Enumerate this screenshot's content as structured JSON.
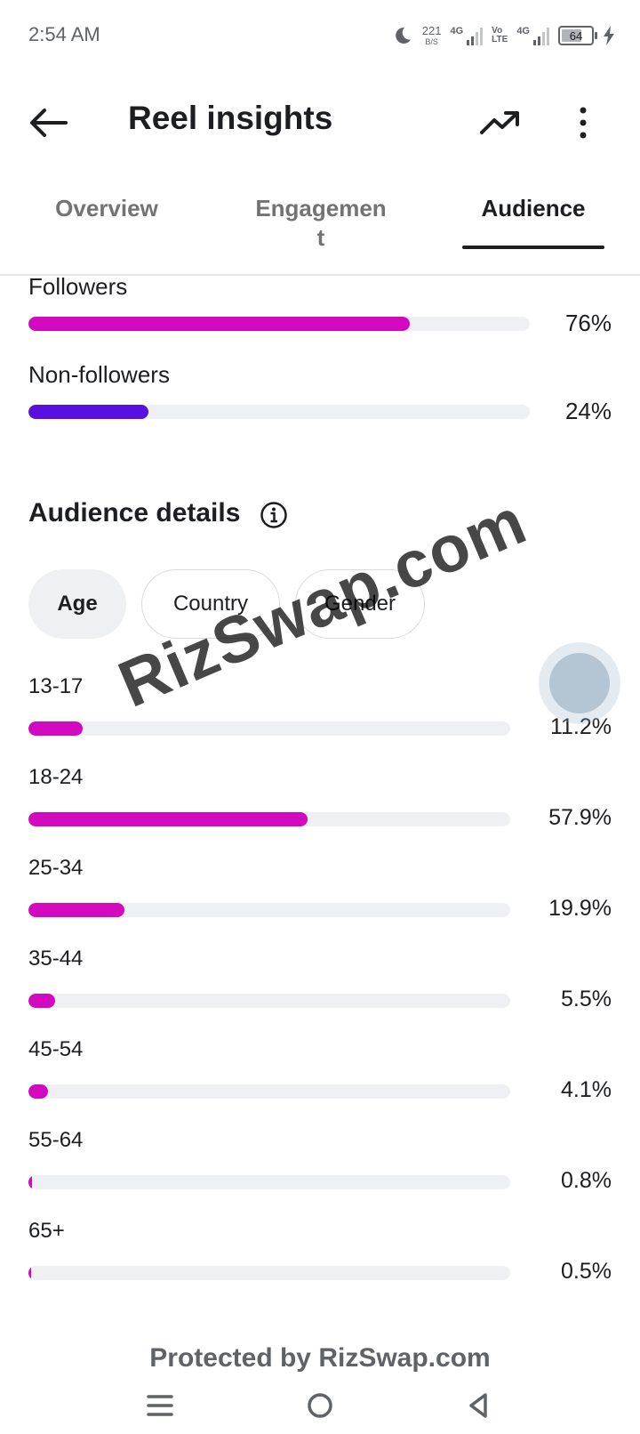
{
  "status_bar": {
    "time": "2:54 AM",
    "net_speed_value": "221",
    "net_speed_unit": "B/S",
    "sim1_label": "4G",
    "volte_top": "Vo",
    "volte_bottom": "LTE",
    "sim2_label": "4G",
    "battery_level": "64"
  },
  "header": {
    "title": "Reel insights",
    "icons": [
      "back-arrow-icon",
      "trending-up-icon",
      "more-vertical-icon"
    ]
  },
  "tabs": [
    {
      "label": "Overview",
      "active": false
    },
    {
      "label": "Engagemen\nt",
      "active": false
    },
    {
      "label": "Audience",
      "active": true
    }
  ],
  "follower_split": [
    {
      "label": "Followers",
      "percent": 76,
      "value_text": "76%",
      "color": "#d309c0"
    },
    {
      "label": "Non-followers",
      "percent": 24,
      "value_text": "24%",
      "color": "#5710e0"
    }
  ],
  "audience_details": {
    "title": "Audience details",
    "filters": [
      {
        "label": "Age",
        "selected": true
      },
      {
        "label": "Country",
        "selected": false
      },
      {
        "label": "Gender",
        "selected": false
      }
    ],
    "bar_color": "#d309c0",
    "track_color": "#eff0f4",
    "age_groups": [
      {
        "label": "13-17",
        "percent": 11.2,
        "value_text": "11.2%"
      },
      {
        "label": "18-24",
        "percent": 57.9,
        "value_text": "57.9%"
      },
      {
        "label": "25-34",
        "percent": 19.9,
        "value_text": "19.9%"
      },
      {
        "label": "35-44",
        "percent": 5.5,
        "value_text": "5.5%"
      },
      {
        "label": "45-54",
        "percent": 4.1,
        "value_text": "4.1%"
      },
      {
        "label": "55-64",
        "percent": 0.8,
        "value_text": "0.8%"
      },
      {
        "label": "65+",
        "percent": 0.5,
        "value_text": "0.5%"
      }
    ]
  },
  "watermark": "RizSwap.com",
  "footer_watermark": "Protected by RizSwap.com",
  "nav_bar": {
    "icons": [
      "menu-icon",
      "home-circle-icon",
      "back-triangle-icon"
    ]
  }
}
